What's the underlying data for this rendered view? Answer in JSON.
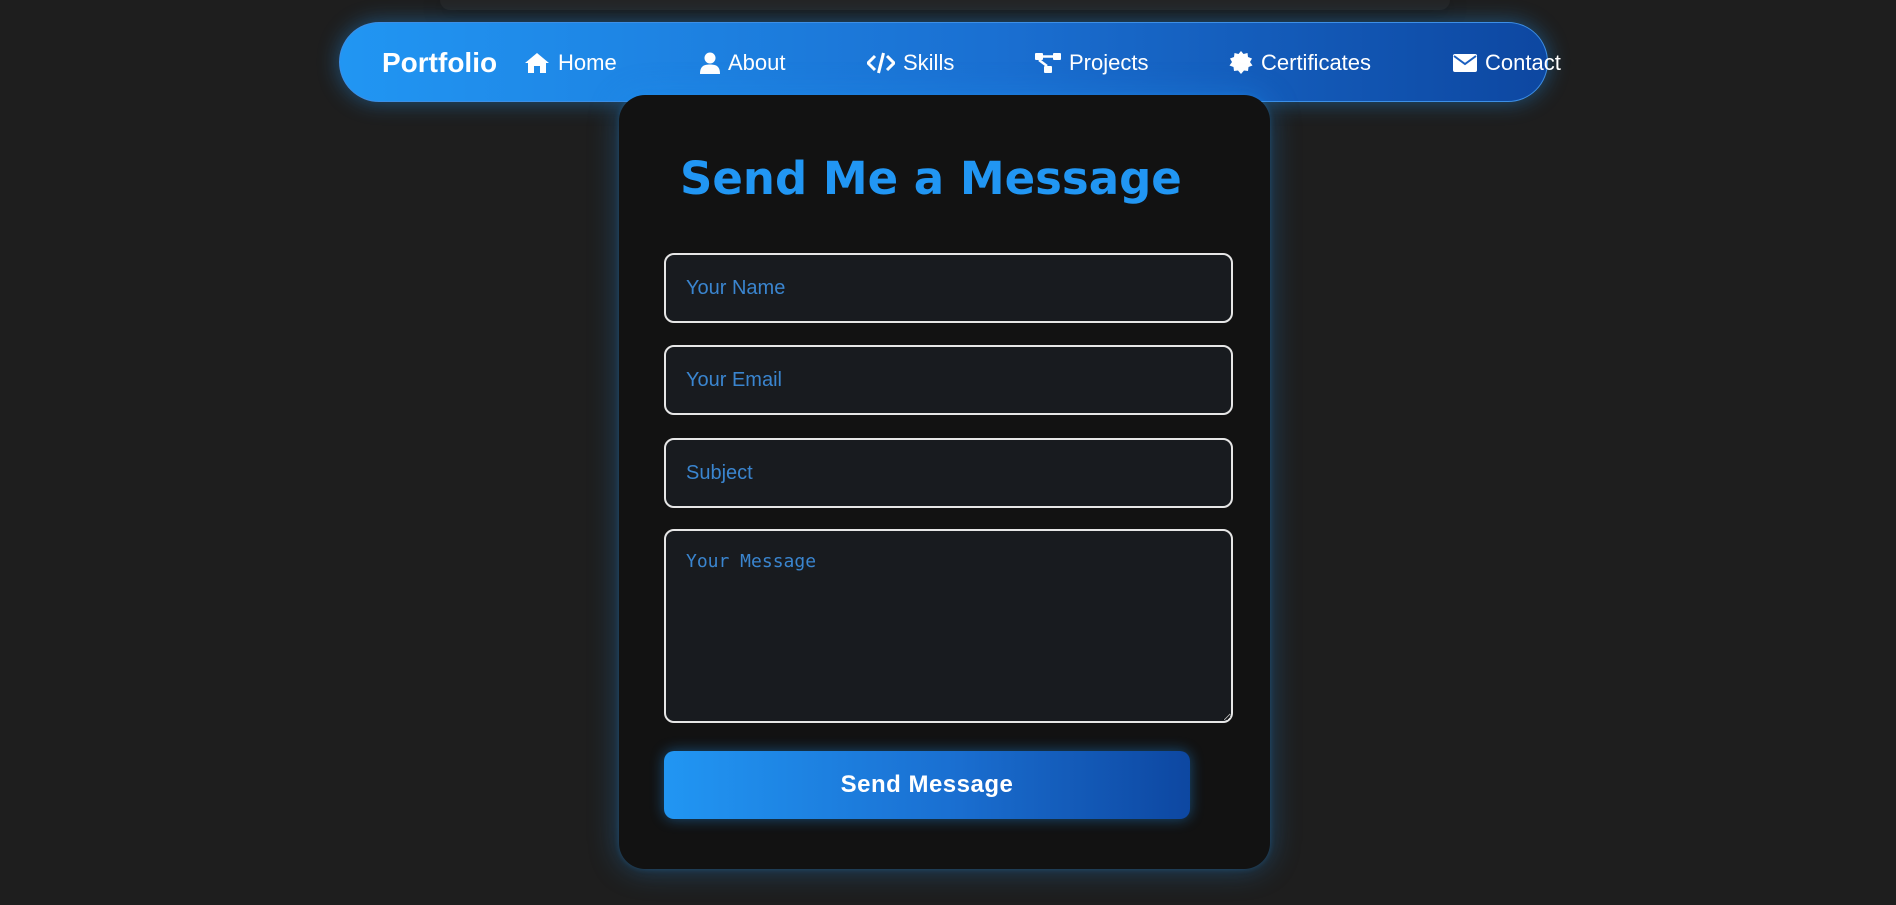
{
  "navbar": {
    "brand": "Portfolio",
    "items": [
      {
        "label": "Home",
        "icon": "home-icon"
      },
      {
        "label": "About",
        "icon": "user-icon"
      },
      {
        "label": "Skills",
        "icon": "code-icon"
      },
      {
        "label": "Projects",
        "icon": "project-diagram-icon"
      },
      {
        "label": "Certificates",
        "icon": "certificate-icon"
      },
      {
        "label": "Contact",
        "icon": "envelope-icon"
      }
    ]
  },
  "form": {
    "title": "Send Me a Message",
    "name_placeholder": "Your Name",
    "email_placeholder": "Your Email",
    "subject_placeholder": "Subject",
    "message_placeholder": "Your Message",
    "submit_label": "Send Message"
  },
  "colors": {
    "accent": "#2196f3",
    "accent_dark": "#0d47a1",
    "background": "#1e1e1e",
    "card": "#121212"
  }
}
